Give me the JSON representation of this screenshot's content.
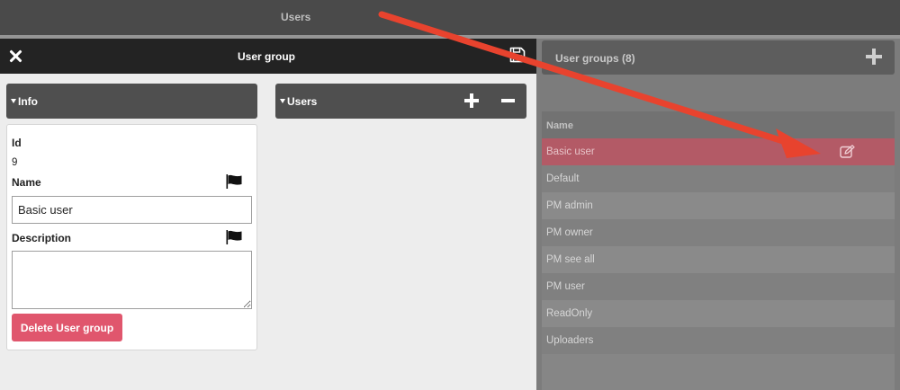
{
  "topbar": {
    "title": "Users"
  },
  "modal": {
    "title": "User group",
    "close_icon": "close-icon",
    "save_icon": "save-icon",
    "info": {
      "header": "Info",
      "id_label": "Id",
      "id_value": "9",
      "name_label": "Name",
      "name_value": "Basic user",
      "description_label": "Description",
      "description_value": "",
      "flag_icon": "flag-icon",
      "delete_label": "Delete User group"
    },
    "users": {
      "header": "Users",
      "add_icon": "plus-icon",
      "remove_icon": "minus-icon"
    }
  },
  "user_groups": {
    "header": "User groups (8)",
    "add_icon": "plus-icon",
    "column": "Name",
    "edit_icon": "edit-icon",
    "selected_index": 0,
    "rows": [
      "Basic user",
      "Default",
      "PM admin",
      "PM owner",
      "PM see all",
      "PM user",
      "ReadOnly",
      "Uploaders"
    ]
  },
  "colors": {
    "accent_delete": "#e0566d",
    "selected_row": "#b35a66",
    "annotation_arrow": "#e8432e"
  }
}
